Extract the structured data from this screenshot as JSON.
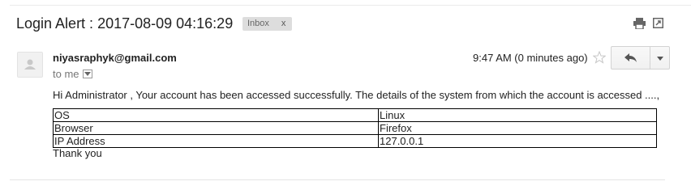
{
  "email": {
    "subject": "Login Alert : 2017-08-09 04:16:29",
    "label": {
      "name": "Inbox",
      "close": "x"
    },
    "sender": "niyasraphyk@gmail.com",
    "to_text": "to me",
    "timestamp": "9:47 AM (0 minutes ago)",
    "greeting": "Hi Administrator , Your account has been accessed successfully. The details of the system from which the account is accessed ....,",
    "details": [
      {
        "key": "OS",
        "value": "Linux"
      },
      {
        "key": "Browser",
        "value": "Firefox"
      },
      {
        "key": "IP Address",
        "value": "127.0.0.1"
      }
    ],
    "closing": "Thank you"
  },
  "icons": {
    "print": "print-icon",
    "new_window": "new-window-icon",
    "star": "star-icon",
    "reply": "reply-icon",
    "more": "chevron-down-icon",
    "avatar": "avatar"
  },
  "colors": {
    "label_bg": "#dddddd",
    "label_text": "#666666",
    "muted_text": "#777777",
    "text": "#222222",
    "table_border": "#000000"
  }
}
